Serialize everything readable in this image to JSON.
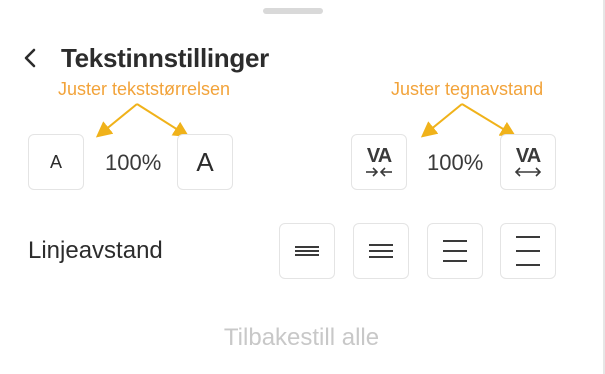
{
  "title": "Tekstinnstillinger",
  "text_size": {
    "hint": "Juster tekststørrelsen",
    "value": "100%",
    "small_glyph": "A",
    "large_glyph": "A"
  },
  "spacing": {
    "hint": "Juster tegnavstand",
    "value": "100%",
    "decrease_glyph": "VA",
    "increase_glyph": "VA"
  },
  "line_spacing": {
    "label": "Linjeavstand"
  },
  "reset_label": "Tilbakestill alle",
  "colors": {
    "accent": "#f2a33a",
    "border": "#e4e4e4",
    "text": "#2c2c2c",
    "disabled": "#c8c8c8"
  },
  "icons": [
    "back-chevron-icon",
    "tight-spacing-icon",
    "wide-spacing-icon",
    "line-spacing-icon"
  ]
}
